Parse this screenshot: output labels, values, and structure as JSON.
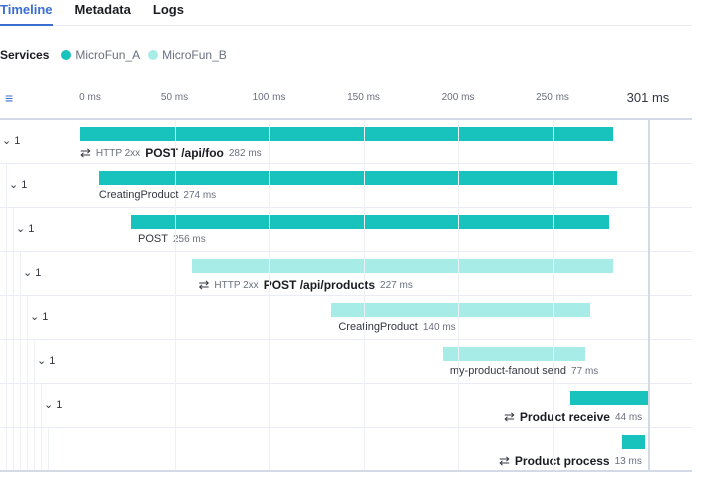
{
  "tabs": [
    {
      "label": "Timeline"
    },
    {
      "label": "Metadata"
    },
    {
      "label": "Logs"
    }
  ],
  "services": {
    "label": "Services",
    "items": [
      {
        "name": "MicroFun_A",
        "color": "#17c3bc"
      },
      {
        "name": "MicroFun_B",
        "color": "#a8ece8"
      }
    ]
  },
  "axis": {
    "ticks": [
      "0 ms",
      "50 ms",
      "100 ms",
      "150 ms",
      "200 ms",
      "250 ms"
    ],
    "tick_values": [
      0,
      50,
      100,
      150,
      200,
      250
    ],
    "end_label": "301 ms",
    "total": 301
  },
  "rows": [
    {
      "count": "1",
      "start": 0,
      "duration": 282,
      "service": 0,
      "status": "HTTP 2xx",
      "name": "POST /api/foo",
      "bold": true,
      "icon": "transaction",
      "dur_label": "282 ms"
    },
    {
      "count": "1",
      "start": 10,
      "duration": 274,
      "service": 0,
      "name": "CreatingProduct",
      "bold": false,
      "dur_label": "274 ms"
    },
    {
      "count": "1",
      "start": 27,
      "duration": 253,
      "service": 0,
      "name": "POST",
      "bold": false,
      "dur_label": "256 ms"
    },
    {
      "count": "1",
      "start": 59,
      "duration": 223,
      "service": 1,
      "status": "HTTP 2xx",
      "name": "POST /api/products",
      "bold": true,
      "icon": "transaction",
      "dur_label": "227 ms"
    },
    {
      "count": "1",
      "start": 133,
      "duration": 137,
      "service": 1,
      "name": "CreatingProduct",
      "bold": false,
      "dur_label": "140 ms"
    },
    {
      "count": "1",
      "start": 192,
      "duration": 75,
      "service": 1,
      "name": "my-product-fanout send",
      "bold": false,
      "dur_label": "77 ms"
    },
    {
      "count": "1",
      "start": 259,
      "duration": 42,
      "service": 0,
      "name": "Product receive",
      "bold": true,
      "icon": "transaction",
      "dur_label": "44 ms"
    },
    {
      "start": 287,
      "duration": 12,
      "service": 0,
      "name": "Product process",
      "bold": true,
      "icon": "transaction",
      "dur_label": "13 ms"
    }
  ]
}
